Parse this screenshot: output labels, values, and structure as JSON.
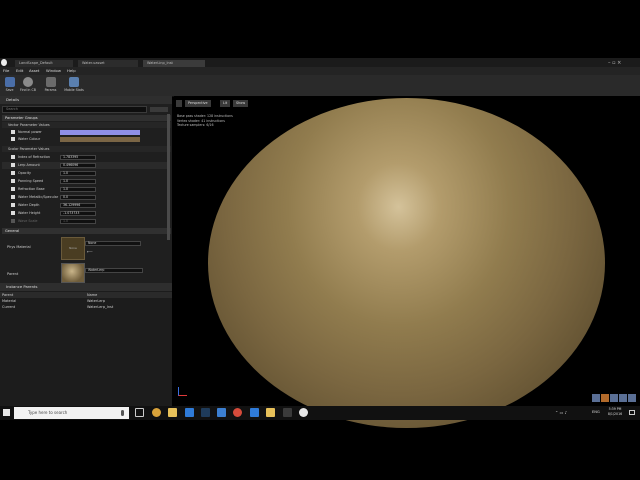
{
  "window": {
    "tabs": [
      "LandScape_Default",
      "Water.uasset",
      "WaterLinp_Inst"
    ],
    "menu": [
      "File",
      "Edit",
      "Asset",
      "Window",
      "Help"
    ]
  },
  "toolbar": {
    "buttons": [
      {
        "label": "Save",
        "icon": "save-icon"
      },
      {
        "label": "Find in CB",
        "icon": "find-in-cb-icon"
      },
      {
        "label": "Params",
        "icon": "params-icon"
      },
      {
        "label": "Mobile Stats",
        "icon": "mobile-stats-icon"
      }
    ]
  },
  "details": {
    "title": "Details",
    "search_placeholder": "Search",
    "parameter_groups": "Parameter Groups",
    "vector_header": "Vector Parameter Values",
    "vector_params": [
      {
        "label": "Normal power",
        "color": "#8f8fe6"
      },
      {
        "label": "Water Colour",
        "color": "#7a6545"
      }
    ],
    "scalar_header": "Scalar Parameter Values",
    "scalar_params": [
      {
        "label": "Index of Refraction",
        "value": "1.783395"
      },
      {
        "label": "Lerp Amount",
        "value": "0.496096"
      },
      {
        "label": "Opacity",
        "value": "1.0"
      },
      {
        "label": "Panning Speed",
        "value": "1.0"
      },
      {
        "label": "Refraction Base",
        "value": "1.0"
      },
      {
        "label": "Water Metallic/Specular",
        "value": "0.0"
      },
      {
        "label": "Water Depth",
        "value": "36.129996"
      },
      {
        "label": "Water Height",
        "value": "-1.073733"
      },
      {
        "label": "Wave Scale",
        "value": "1.0"
      }
    ],
    "general_header": "General",
    "phys_material_label": "Phys Material",
    "phys_material_value": "None",
    "phys_material_thumb": "None",
    "parent_label": "Parent",
    "parent_value": "WaterLerp"
  },
  "instance_parents": {
    "title": "Instance Parents",
    "col_parent": "Parent",
    "col_name": "Name",
    "rows": [
      {
        "parent": "Material",
        "name": "WaterLerp"
      },
      {
        "parent": "Current",
        "name": "WaterLerp_Inst"
      }
    ]
  },
  "viewport": {
    "buttons": [
      "Perspective",
      "Lit",
      "Show"
    ],
    "stats": [
      "Base pass shader: 128 instructions",
      "Vertex shader: 41 instructions",
      "Texture samplers: 6/16"
    ]
  },
  "taskbar": {
    "search_placeholder": "Type here to search",
    "lang": "ENG",
    "time": "5:39 PM",
    "date": "8/1/2016"
  }
}
